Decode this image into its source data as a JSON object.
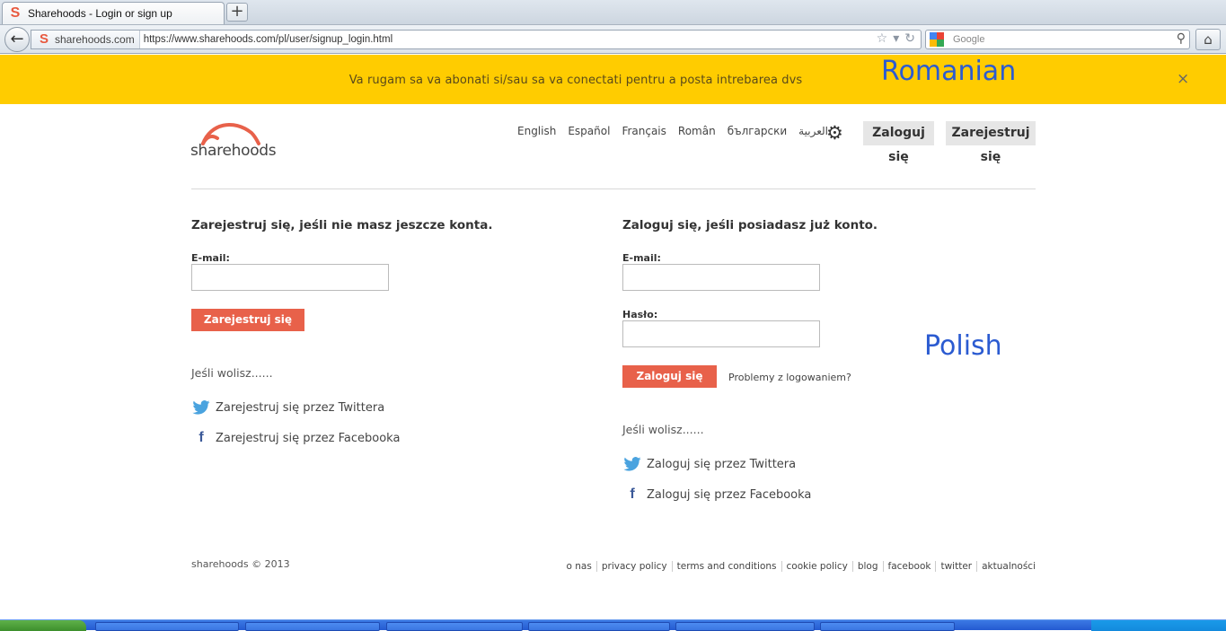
{
  "browser": {
    "tab_title": "Sharehoods - Login or sign up",
    "new_tab_label": "+",
    "identity_label": "sharehoods.com",
    "url": "https://www.sharehoods.com/pl/user/signup_login.html",
    "search_placeholder": "Google"
  },
  "banner": {
    "message": "Va rugam sa va abonati si/sau sa va conectati pentru a posta intrebarea dvs",
    "close_icon": "×"
  },
  "annotations": {
    "romanian": "Romanian",
    "polish": "Polish"
  },
  "header": {
    "logo_text": "sharehoods",
    "languages": [
      "English",
      "Español",
      "Français",
      "Român",
      "български",
      "العربية"
    ],
    "login_label": "Zaloguj się",
    "register_label": "Zarejestruj się"
  },
  "signup": {
    "heading": "Zarejestruj się, jeśli nie masz jeszcze konta.",
    "email_label": "E-mail:",
    "email_value": "",
    "submit_label": "Zarejestruj się",
    "alt_text": "Jeśli wolisz......",
    "twitter_label": "Zarejestruj się przez Twittera",
    "facebook_label": "Zarejestruj się przez Facebooka"
  },
  "login": {
    "heading": "Zaloguj się, jeśli posiadasz już konto.",
    "email_label": "E-mail:",
    "email_value": "",
    "password_label": "Hasło:",
    "password_value": "",
    "submit_label": "Zaloguj się",
    "trouble_link": "Problemy z logowaniem?",
    "alt_text": "Jeśli wolisz......",
    "twitter_label": "Zaloguj się przez Twittera",
    "facebook_label": "Zaloguj się przez Facebooka"
  },
  "footer": {
    "copyright": "sharehoods © 2013",
    "links": [
      "o nas",
      "privacy policy",
      "terms and conditions",
      "cookie policy",
      "blog",
      "facebook",
      "twitter",
      "aktualności"
    ]
  },
  "colors": {
    "accent": "#e8614a",
    "banner": "#ffcc00",
    "annotation": "#2b5bd1",
    "twitter": "#4aa3df",
    "facebook": "#3b5998"
  },
  "icons": [
    "back-arrow-icon",
    "bookmark-star-icon",
    "dropdown-icon",
    "reload-icon",
    "search-icon",
    "home-icon",
    "close-icon",
    "gear-icon",
    "twitter-icon",
    "facebook-icon"
  ]
}
